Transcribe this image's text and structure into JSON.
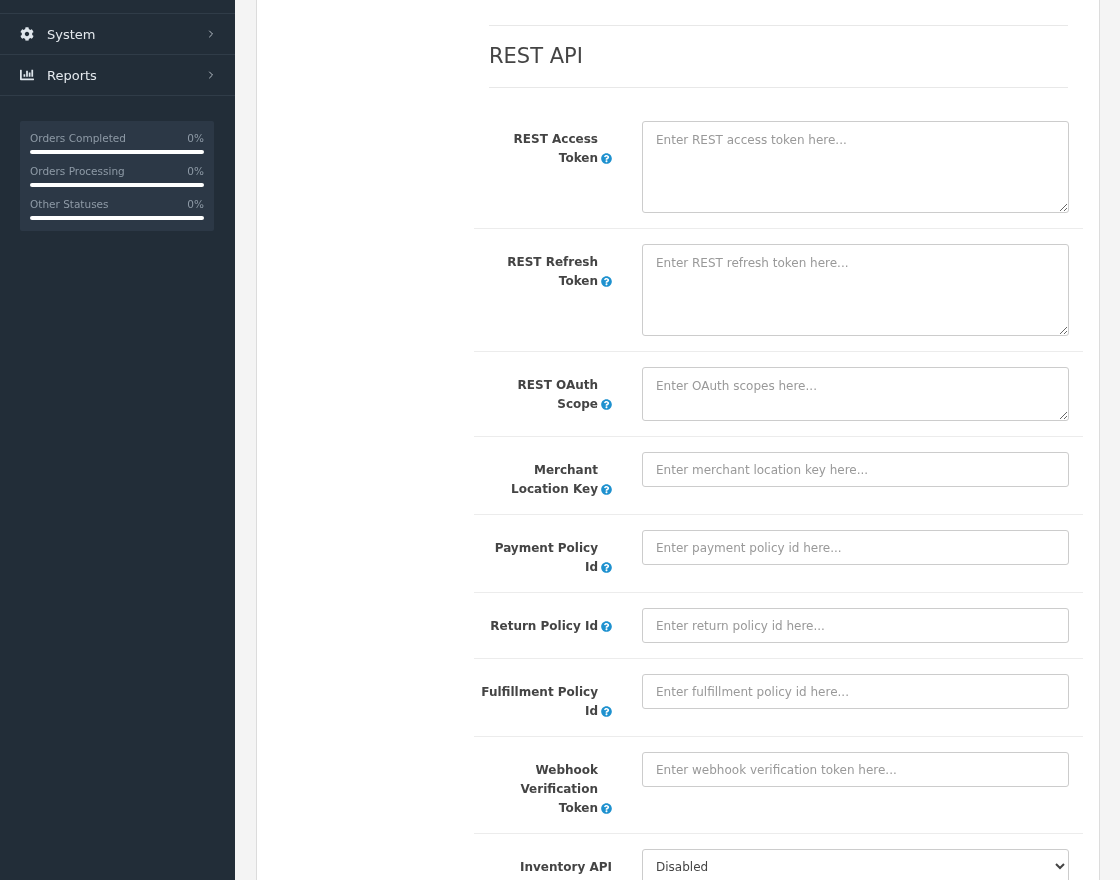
{
  "sidebar": {
    "menu": [
      {
        "label": "System",
        "expanded": false
      },
      {
        "label": "Reports",
        "expanded": false
      }
    ],
    "stats": [
      {
        "label": "Orders Completed",
        "value": "0%",
        "level": 0
      },
      {
        "label": "Orders Processing",
        "value": "0%",
        "level": 0
      },
      {
        "label": "Other Statuses",
        "value": "0%",
        "level": 0
      }
    ]
  },
  "section": {
    "title": "REST API",
    "fields": [
      {
        "label": "REST Access Token",
        "help": true,
        "kind": "textarea",
        "placeholder": "Enter REST access token here..."
      },
      {
        "label": "REST Refresh Token",
        "help": true,
        "kind": "textarea",
        "placeholder": "Enter REST refresh token here..."
      },
      {
        "label": "REST OAuth Scope",
        "help": true,
        "kind": "textarea-short",
        "placeholder": "Enter OAuth scopes here..."
      },
      {
        "label": "Merchant Location Key",
        "help": true,
        "kind": "input",
        "placeholder": "Enter merchant location key here..."
      },
      {
        "label": "Payment Policy Id",
        "help": true,
        "kind": "input",
        "placeholder": "Enter payment policy id here..."
      },
      {
        "label": "Return Policy Id",
        "help": true,
        "kind": "input",
        "placeholder": "Enter return policy id here..."
      },
      {
        "label": "Fulfillment Policy Id",
        "help": true,
        "kind": "input",
        "placeholder": "Enter fulfillment policy id here..."
      },
      {
        "label": "Webhook Verification Token",
        "help": true,
        "kind": "input",
        "placeholder": "Enter webhook verification token here..."
      },
      {
        "label": "Inventory API",
        "help": false,
        "kind": "select",
        "value": "Disabled"
      }
    ]
  }
}
